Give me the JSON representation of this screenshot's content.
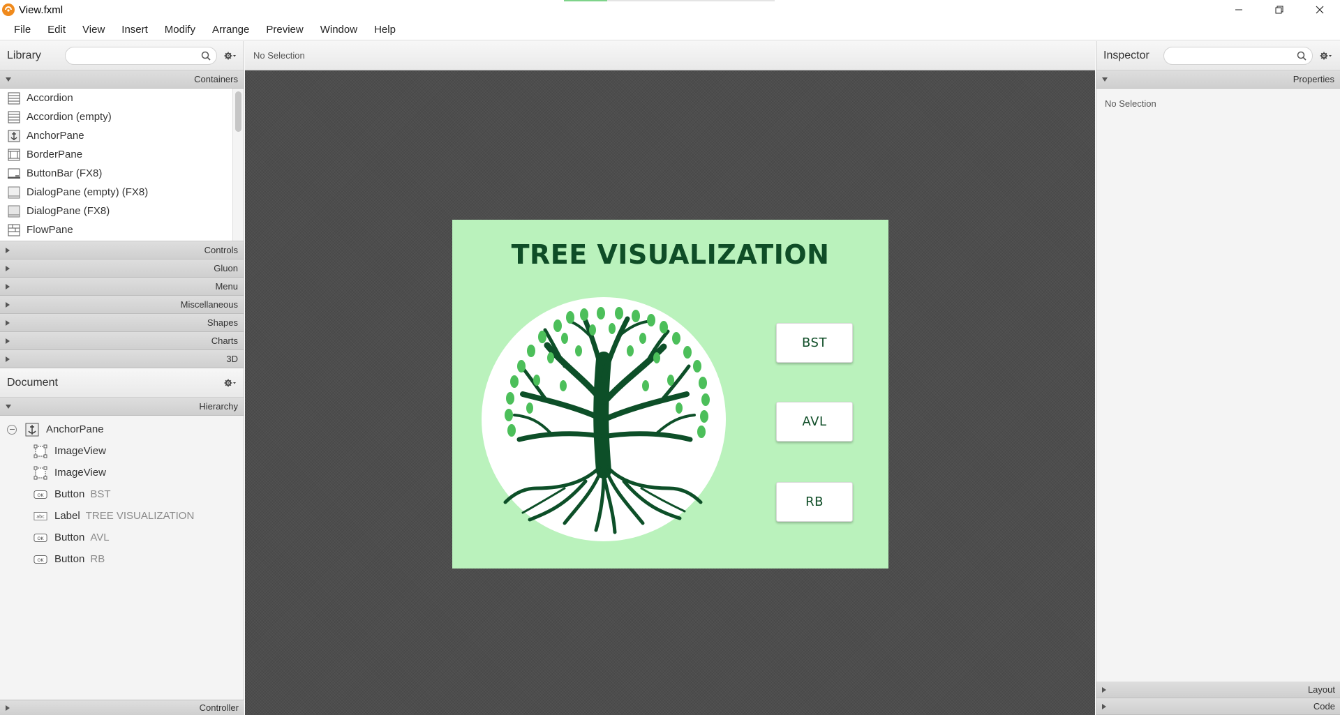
{
  "window": {
    "title": "View.fxml",
    "controls": [
      "minimize-icon",
      "restore-icon",
      "close-icon"
    ]
  },
  "menubar": {
    "items": [
      "File",
      "Edit",
      "View",
      "Insert",
      "Modify",
      "Arrange",
      "Preview",
      "Window",
      "Help"
    ]
  },
  "library": {
    "title": "Library",
    "search_placeholder": "",
    "open_section": "Containers",
    "items": [
      {
        "label": "Accordion",
        "icon": "accordion-icon"
      },
      {
        "label": "Accordion  (empty)",
        "icon": "accordion-icon"
      },
      {
        "label": "AnchorPane",
        "icon": "anchorpane-icon"
      },
      {
        "label": "BorderPane",
        "icon": "borderpane-icon"
      },
      {
        "label": "ButtonBar  (FX8)",
        "icon": "buttonbar-icon"
      },
      {
        "label": "DialogPane (empty)  (FX8)",
        "icon": "dialogpane-icon"
      },
      {
        "label": "DialogPane  (FX8)",
        "icon": "dialogpane-icon"
      },
      {
        "label": "FlowPane",
        "icon": "flowpane-icon"
      }
    ],
    "sections": [
      "Controls",
      "Gluon",
      "Menu",
      "Miscellaneous",
      "Shapes",
      "Charts",
      "3D"
    ]
  },
  "document": {
    "title": "Document",
    "section": "Hierarchy",
    "root": {
      "label": "AnchorPane",
      "icon": "anchorpane-icon"
    },
    "children": [
      {
        "label": "ImageView",
        "sub": "",
        "icon": "imageview-icon"
      },
      {
        "label": "ImageView",
        "sub": "",
        "icon": "imageview-icon"
      },
      {
        "label": "Button",
        "sub": "BST",
        "icon": "button-icon"
      },
      {
        "label": "Label",
        "sub": "TREE VISUALIZATION",
        "icon": "label-icon"
      },
      {
        "label": "Button",
        "sub": "AVL",
        "icon": "button-icon"
      },
      {
        "label": "Button",
        "sub": "RB",
        "icon": "button-icon"
      }
    ],
    "controller": "Controller"
  },
  "center": {
    "selection_text": "No Selection"
  },
  "scene": {
    "title": "TREE VISUALIZATION",
    "buttons": [
      "BST",
      "AVL",
      "RB"
    ],
    "colors": {
      "background": "#baf2bc",
      "title": "#0f4d27",
      "tree": "#0d4f28",
      "leaf": "#4cbf5a"
    }
  },
  "inspector": {
    "title": "Inspector",
    "search_placeholder": "",
    "section": "Properties",
    "no_selection": "No Selection",
    "bottom_sections": [
      "Layout",
      "Code"
    ]
  }
}
